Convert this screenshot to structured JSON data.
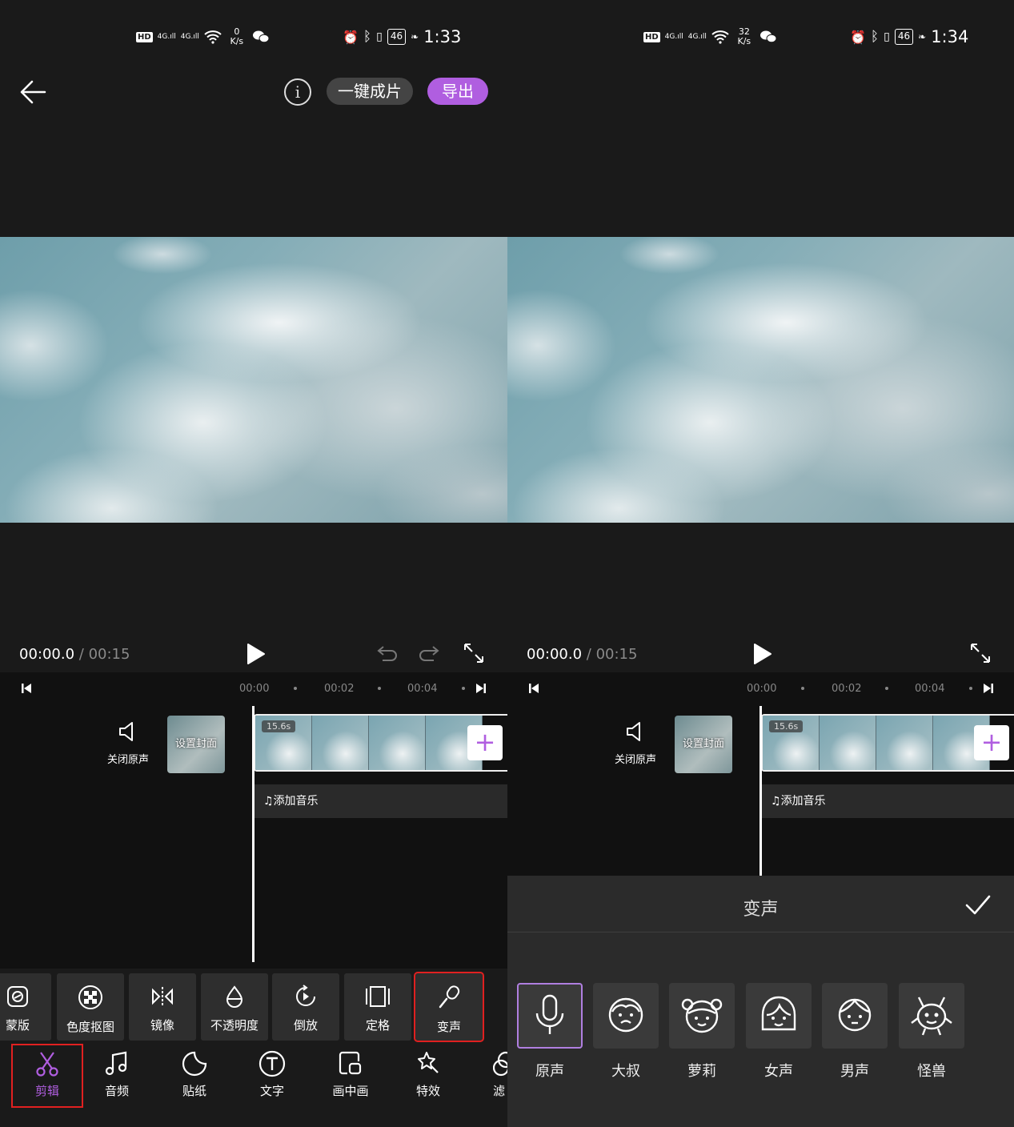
{
  "left": {
    "status": {
      "signal1": "4G",
      "signal2": "4G",
      "net_speed_value": "0",
      "net_speed_unit": "K/s",
      "battery": "46",
      "time": "1:33"
    },
    "header": {
      "one_click_label": "一键成片",
      "export_label": "导出",
      "info_glyph": "i"
    },
    "player": {
      "current": "00:00.0",
      "total": "/ 00:15"
    },
    "ruler": {
      "ticks": [
        "00:00",
        "00:02",
        "00:04"
      ]
    },
    "track": {
      "mute_label": "关闭原声",
      "cover_label": "设置封面",
      "clip_duration": "15.6s",
      "add_clip_glyph": "+",
      "music_label": "添加音乐"
    },
    "tools": [
      {
        "label": "蒙版",
        "icon": "mask-icon"
      },
      {
        "label": "色度抠图",
        "icon": "chroma-key-icon"
      },
      {
        "label": "镜像",
        "icon": "mirror-icon"
      },
      {
        "label": "不透明度",
        "icon": "opacity-icon"
      },
      {
        "label": "倒放",
        "icon": "reverse-icon"
      },
      {
        "label": "定格",
        "icon": "freeze-frame-icon"
      },
      {
        "label": "变声",
        "icon": "voice-changer-icon",
        "selected": true
      }
    ],
    "tabs": [
      {
        "label": "剪辑",
        "icon": "scissors-icon",
        "selected": true
      },
      {
        "label": "音频",
        "icon": "music-note-icon"
      },
      {
        "label": "贴纸",
        "icon": "sticker-icon"
      },
      {
        "label": "文字",
        "icon": "text-icon"
      },
      {
        "label": "画中画",
        "icon": "picture-in-picture-icon"
      },
      {
        "label": "特效",
        "icon": "effects-icon"
      },
      {
        "label": "滤",
        "icon": "filter-icon"
      }
    ]
  },
  "right": {
    "status": {
      "signal1": "4G",
      "signal2": "4G",
      "net_speed_value": "32",
      "net_speed_unit": "K/s",
      "battery": "46",
      "time": "1:34"
    },
    "player": {
      "current": "00:00.0",
      "total": "/ 00:15"
    },
    "ruler": {
      "ticks": [
        "00:00",
        "00:02",
        "00:04"
      ]
    },
    "track": {
      "mute_label": "关闭原声",
      "cover_label": "设置封面",
      "clip_duration": "15.6s",
      "add_clip_glyph": "+",
      "music_label": "添加音乐"
    },
    "sheet": {
      "title": "变声",
      "voices": [
        {
          "label": "原声",
          "icon": "microphone-icon",
          "selected": true
        },
        {
          "label": "大叔",
          "icon": "uncle-face-icon"
        },
        {
          "label": "萝莉",
          "icon": "girl-face-icon"
        },
        {
          "label": "女声",
          "icon": "female-face-icon"
        },
        {
          "label": "男声",
          "icon": "male-face-icon"
        },
        {
          "label": "怪兽",
          "icon": "monster-face-icon"
        }
      ]
    }
  },
  "colors": {
    "accent": "#b05ee0",
    "highlight_box": "#e02020",
    "background": "#1a1a1a"
  }
}
